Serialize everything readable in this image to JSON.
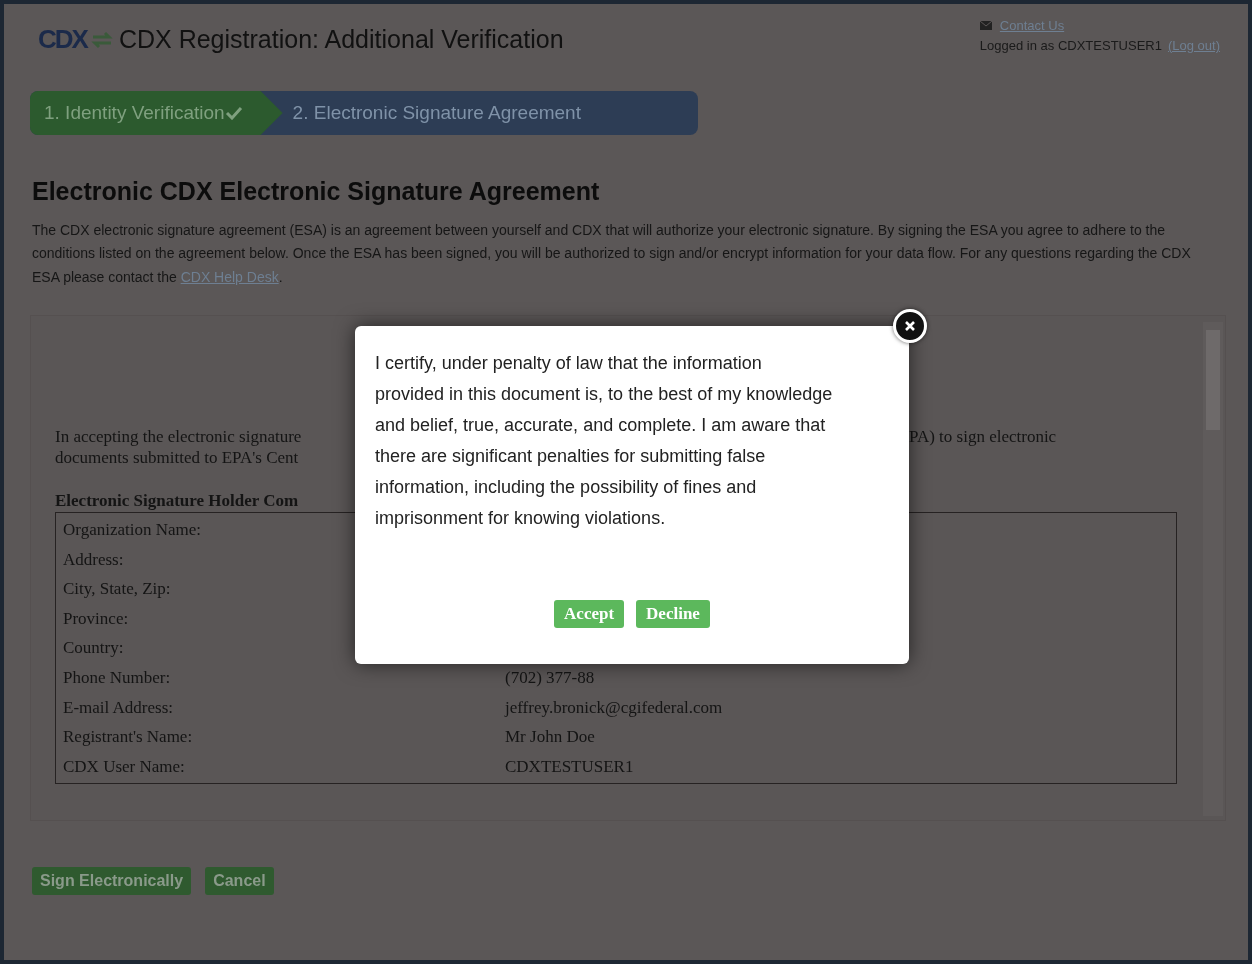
{
  "header": {
    "logo": "CDX",
    "title": "CDX Registration: Additional Verification",
    "contact_link": "Contact Us",
    "logged_in_text": "Logged in as CDXTESTUSER1",
    "logout_link": "(Log out)"
  },
  "steps": [
    {
      "label": "1. Identity Verification",
      "completed": true,
      "selected": false
    },
    {
      "label": "2. Electronic Signature Agreement",
      "completed": false,
      "selected": true
    }
  ],
  "heading": "Electronic CDX Electronic Signature Agreement",
  "intro": {
    "text": "The CDX electronic signature agreement (ESA) is an agreement between yourself and CDX that will authorize your electronic signature. By signing the ESA you agree to adhere to the conditions listed on the agreement below. Once the ESA has been signed, you will be authorized to sign and/or encrypt information for your data flow. For any questions regarding the CDX ESA please contact the ",
    "link": "CDX Help Desk",
    "after": "."
  },
  "document": {
    "intro_lines": [
      {
        "left": "In accepting the electronic signature",
        "right": "PA) to sign electronic"
      },
      {
        "left": "documents submitted to EPA's Cent"
      }
    ],
    "section_heading": "Electronic Signature Holder Com",
    "fields": [
      {
        "label": "Organization Name:"
      },
      {
        "label": "Address:"
      },
      {
        "label": "City, State, Zip:"
      },
      {
        "label": "Province:"
      },
      {
        "label": "Country:"
      },
      {
        "label": "Phone Number:",
        "value": "(702) 377-88"
      },
      {
        "label": "E-mail Address:",
        "value": "jeffrey.bronick@cgifederal.com"
      },
      {
        "label": "Registrant's Name:",
        "value": "Mr John Doe"
      },
      {
        "label": "CDX User Name:",
        "value": "CDXTESTUSER1"
      }
    ]
  },
  "actions": [
    "Sign Electronically",
    "Cancel"
  ],
  "modal": {
    "text": "I certify, under penalty of law that the information provided in this document is, to the best of my knowledge and belief, true, accurate, and complete. I am aware that there are significant penalties for submitting false information, including the possibility of fines and imprisonment for knowing violations.",
    "buttons": [
      "Accept",
      "Decline"
    ]
  }
}
